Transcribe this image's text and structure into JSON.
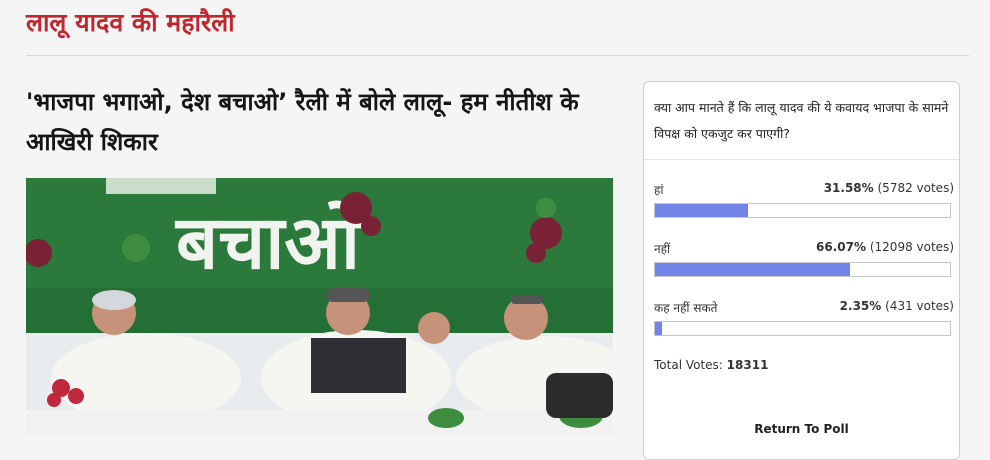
{
  "section": {
    "title": "लालू यादव की महारैली"
  },
  "article": {
    "headline": "'भाजपा भगाओ, देश बचाओ’ रैली में बोले लालू- हम नीतीश के आखिरी शिकार",
    "banner_text": "बचाओ"
  },
  "poll": {
    "question": "क्या आप मानते हैं कि लालू यादव की ये कवायद भाजपा के सामने विपक्ष को एकजुट कर पाएगी?",
    "options": [
      {
        "label": "हां",
        "percent_text": "31.58%",
        "votes_text": "(5782 votes)",
        "percent": 31.58
      },
      {
        "label": "नहीं",
        "percent_text": "66.07%",
        "votes_text": "(12098 votes)",
        "percent": 66.07
      },
      {
        "label": "कह नहीं सकते",
        "percent_text": "2.35%",
        "votes_text": "(431 votes)",
        "percent": 2.35
      }
    ],
    "total_label": "Total Votes:",
    "total_value": "18311",
    "return_label": "Return To Poll",
    "bar_color": "#7384e8"
  },
  "colors": {
    "accent": "#c0262d",
    "banner_green": "#1f6d34"
  }
}
